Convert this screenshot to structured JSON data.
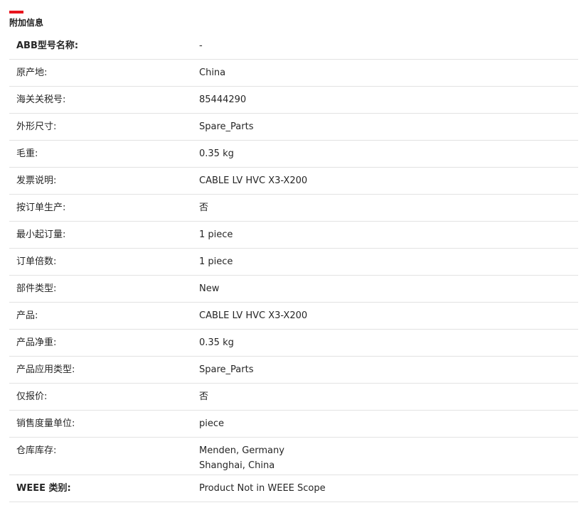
{
  "section": {
    "title": "附加信息"
  },
  "rows": [
    {
      "label": "ABB型号名称:",
      "value": "-"
    },
    {
      "label": "原产地:",
      "value": "China"
    },
    {
      "label": "海关关税号:",
      "value": "85444290"
    },
    {
      "label": "外形尺寸:",
      "value": "Spare_Parts"
    },
    {
      "label": "毛重:",
      "value": "0.35 kg"
    },
    {
      "label": "发票说明:",
      "value": "CABLE LV HVC X3-X200"
    },
    {
      "label": "按订单生产:",
      "value": "否"
    },
    {
      "label": "最小起订量:",
      "value": "1 piece"
    },
    {
      "label": "订单倍数:",
      "value": "1 piece"
    },
    {
      "label": "部件类型:",
      "value": "New"
    },
    {
      "label": "产品:",
      "value": "CABLE LV HVC X3-X200"
    },
    {
      "label": "产品净重:",
      "value": "0.35 kg"
    },
    {
      "label": "产品应用类型:",
      "value": "Spare_Parts"
    },
    {
      "label": "仅报价:",
      "value": "否"
    },
    {
      "label": "销售度量单位:",
      "value": "piece"
    },
    {
      "label": "仓库库存:",
      "value_lines": [
        "Menden, Germany",
        "Shanghai, China"
      ]
    },
    {
      "label": "WEEE 类别:",
      "value": "Product Not in WEEE Scope"
    }
  ],
  "colors": {
    "accent": "#e8141e",
    "divider": "#e2e2e2",
    "text": "#262626"
  }
}
